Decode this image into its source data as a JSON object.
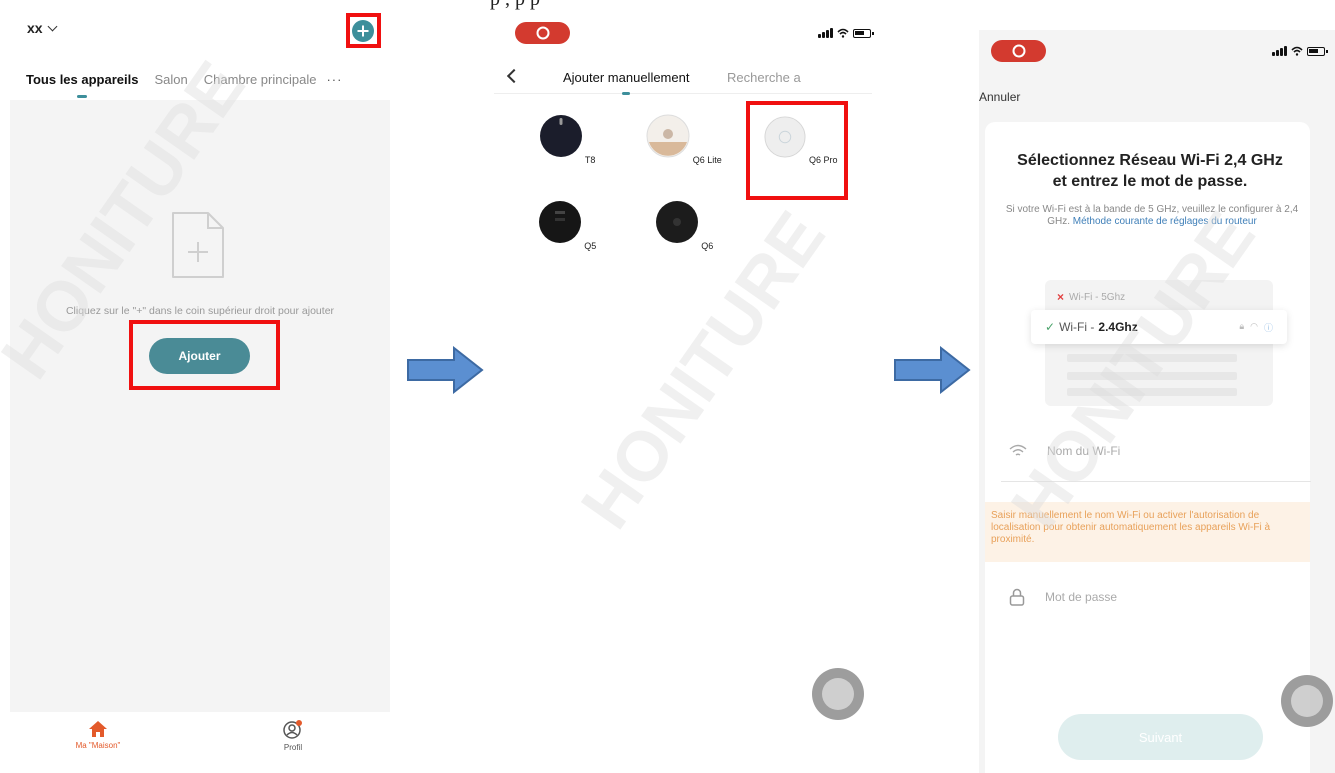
{
  "caption": "p                   , p   p",
  "screen1": {
    "home_name": "xx",
    "tabs": [
      "Tous les appareils",
      "Salon",
      "Chambre principale"
    ],
    "more": "···",
    "empty_text": "Cliquez sur le \"+\" dans le coin supérieur droit pour ajouter",
    "add_button": "Ajouter",
    "nav_home": "Ma \"Maison\"",
    "nav_profile": "Profil",
    "accent_color": "#3d8f9b",
    "nav_home_color": "#e35a2b"
  },
  "screen2": {
    "tab_manual": "Ajouter manuellement",
    "tab_search": "Recherche a",
    "devices": [
      {
        "label": "T8",
        "color": "#1b1d2b"
      },
      {
        "label": "Q6 Lite",
        "color": "#f3efea"
      },
      {
        "label": "Q6 Pro",
        "color": "#eaeaea"
      },
      {
        "label": "Q5",
        "color": "#161616"
      },
      {
        "label": "Q6",
        "color": "#1c1c1c"
      }
    ]
  },
  "screen3": {
    "cancel": "Annuler",
    "title_line1": "Sélectionnez Réseau Wi-Fi 2,4 GHz",
    "title_line2": "et entrez le mot de passe.",
    "sub_text": "Si votre Wi-Fi est à  la bande de 5 GHz, veuillez le configurer à 2,4 GHz.",
    "sub_link": "Méthode courante de réglages du routeur",
    "wifi_5_prefix": "Wi-Fi - ",
    "wifi_5_band": "5Ghz",
    "wifi_24_prefix": "Wi-Fi - ",
    "wifi_24_band": "2.4Ghz",
    "wifi_name_placeholder": "Nom du Wi-Fi",
    "warning": "Saisir manuellement le nom Wi-Fi ou activer l'autorisation de localisation pour obtenir automatiquement les appareils Wi-Fi à proximité.",
    "password_placeholder": "Mot de passe",
    "next_button": "Suivant",
    "warning_color": "#e8a15a",
    "link_color": "#3f7fb8"
  },
  "watermark": "HONITURE"
}
